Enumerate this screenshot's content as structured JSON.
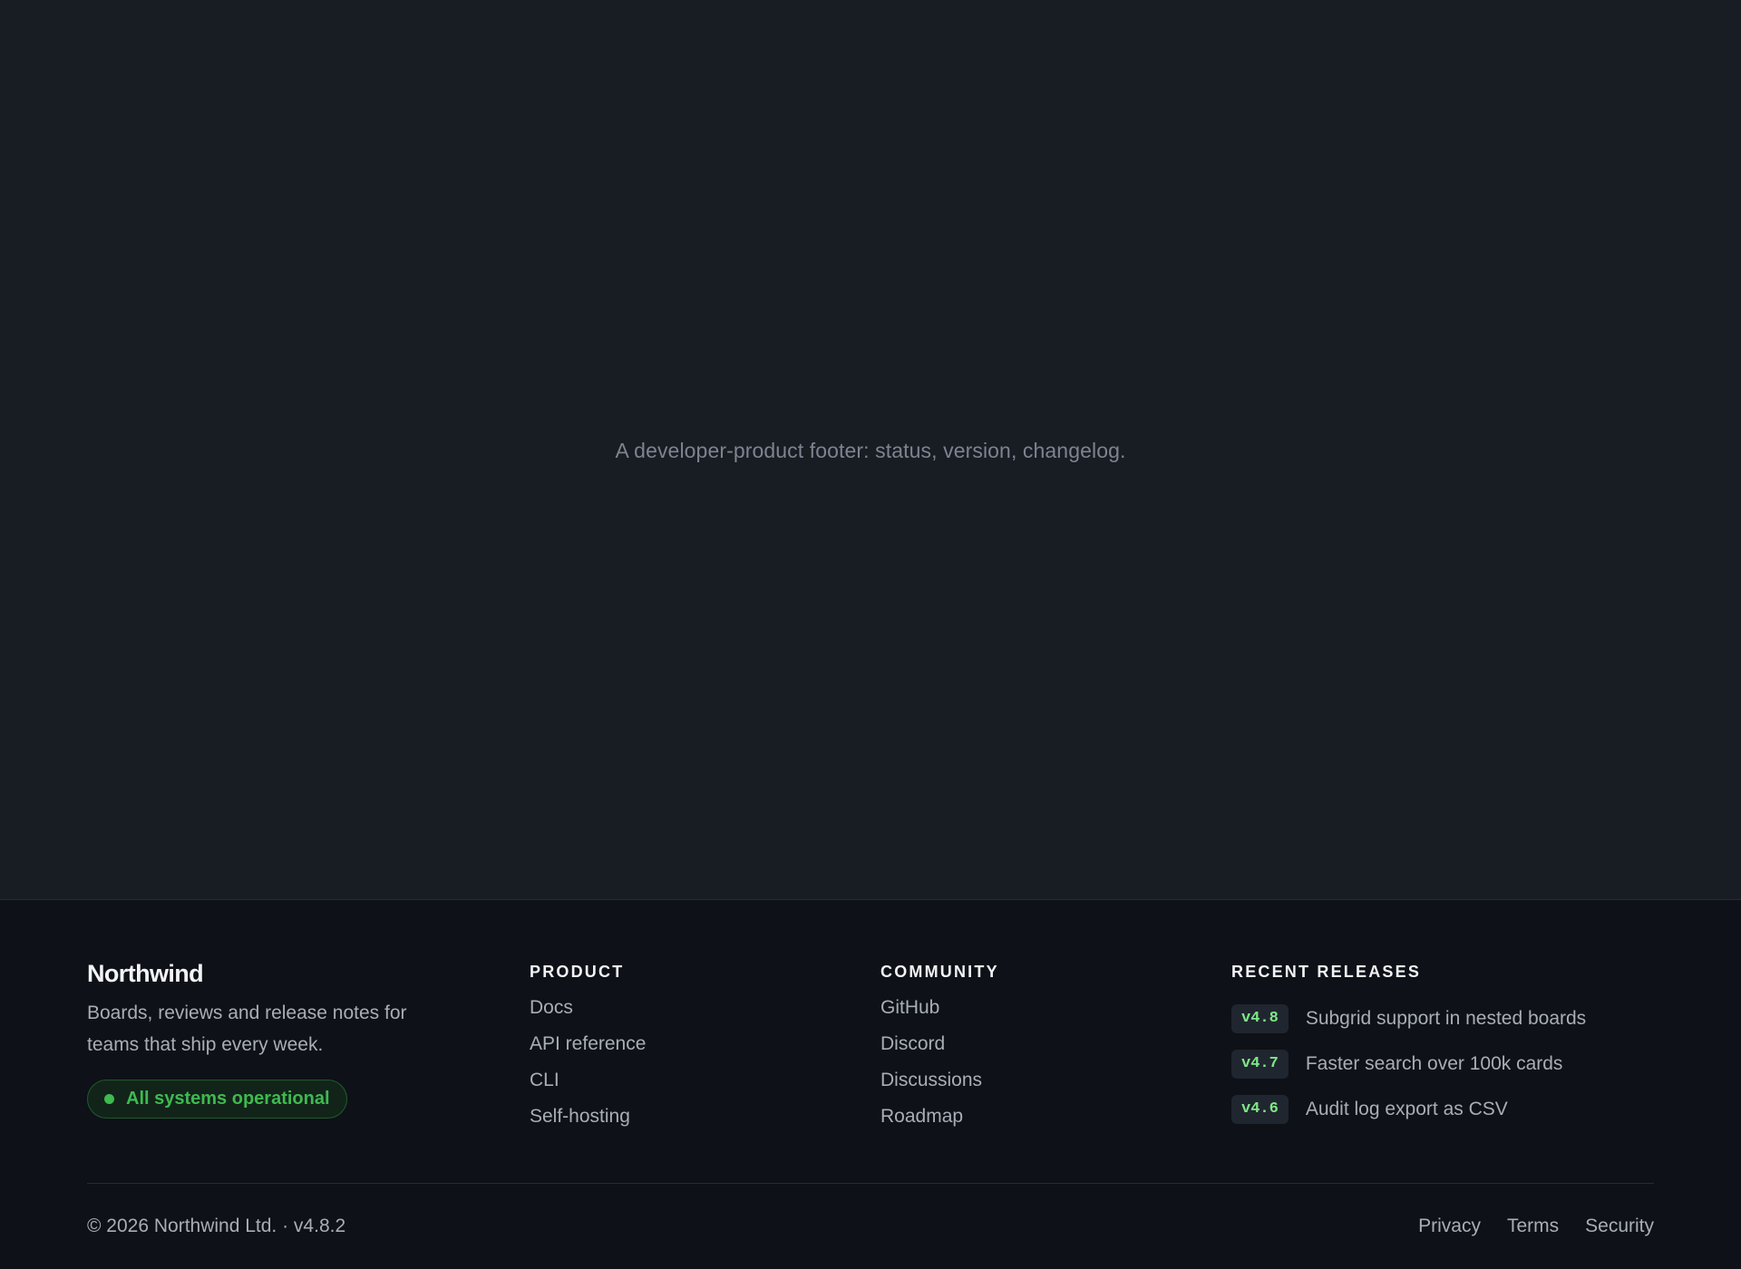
{
  "hero": {
    "caption": "A developer-product footer: status, version, changelog."
  },
  "footer": {
    "brand": {
      "name": "Northwind",
      "description": "Boards, reviews and release notes for teams that ship every week.",
      "status": "All systems operational",
      "status_color": "#3fb950"
    },
    "product": {
      "heading": "PRODUCT",
      "links": [
        "Docs",
        "API reference",
        "CLI",
        "Self-hosting"
      ]
    },
    "community": {
      "heading": "COMMUNITY",
      "links": [
        "GitHub",
        "Discord",
        "Discussions",
        "Roadmap"
      ]
    },
    "releases": {
      "heading": "RECENT RELEASES",
      "items": [
        {
          "version": "v4.8",
          "text": "Subgrid support in nested boards"
        },
        {
          "version": "v4.7",
          "text": "Faster search over 100k cards"
        },
        {
          "version": "v4.6",
          "text": "Audit log export as CSV"
        }
      ]
    },
    "bottom": {
      "copyright": "© 2026 Northwind Ltd. · v4.8.2",
      "legal_links": [
        "Privacy",
        "Terms",
        "Security"
      ]
    }
  }
}
